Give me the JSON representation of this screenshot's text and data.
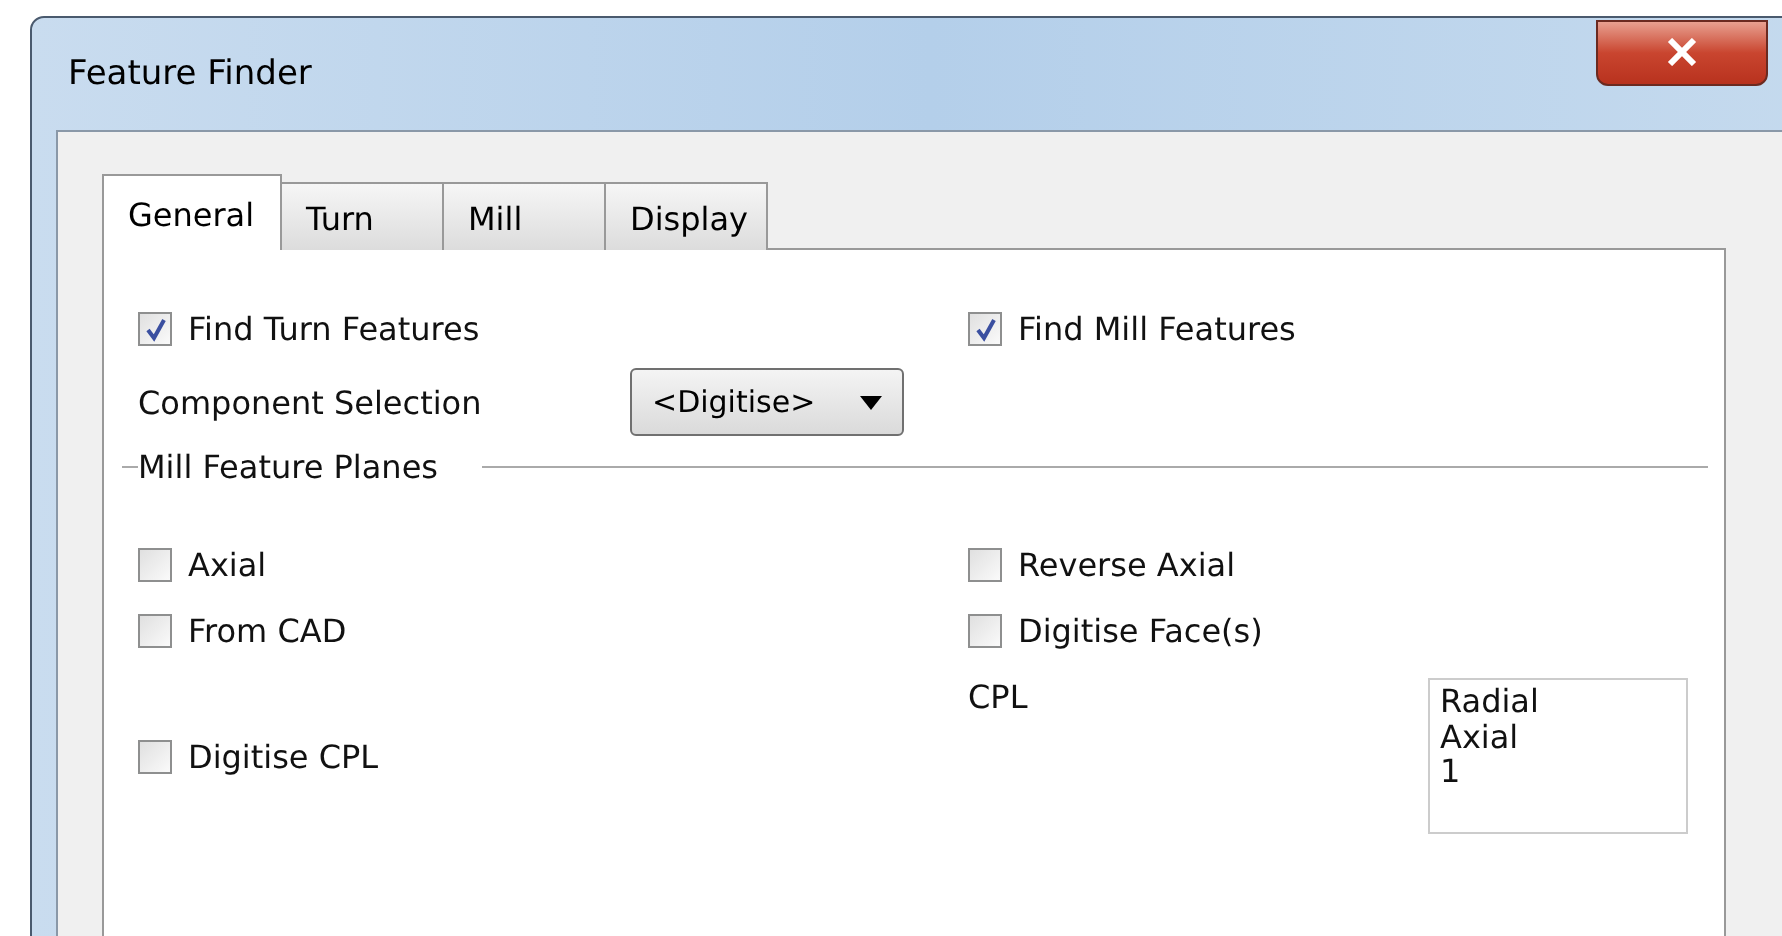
{
  "window": {
    "title": "Feature Finder"
  },
  "tabs": [
    {
      "label": "General",
      "selected": true
    },
    {
      "label": "Turn",
      "selected": false
    },
    {
      "label": "Mill",
      "selected": false
    },
    {
      "label": "Display",
      "selected": false
    }
  ],
  "find_options": [
    {
      "label": "Find Turn Features",
      "checked": true
    },
    {
      "label": "Find Mill Features",
      "checked": true
    }
  ],
  "component_selection": {
    "label": "Component Selection",
    "value": "<Digitise>"
  },
  "mill_feature_planes": {
    "heading": "Mill Feature Planes",
    "options": [
      {
        "label": "Axial",
        "checked": false
      },
      {
        "label": "Reverse Axial",
        "checked": false
      },
      {
        "label": "From CAD",
        "checked": false
      },
      {
        "label": "Digitise Face(s)",
        "checked": false
      },
      {
        "label": "Digitise CPL",
        "checked": false
      }
    ],
    "cpl": {
      "label": "CPL",
      "items": [
        "Radial",
        "Axial",
        "1"
      ]
    }
  }
}
